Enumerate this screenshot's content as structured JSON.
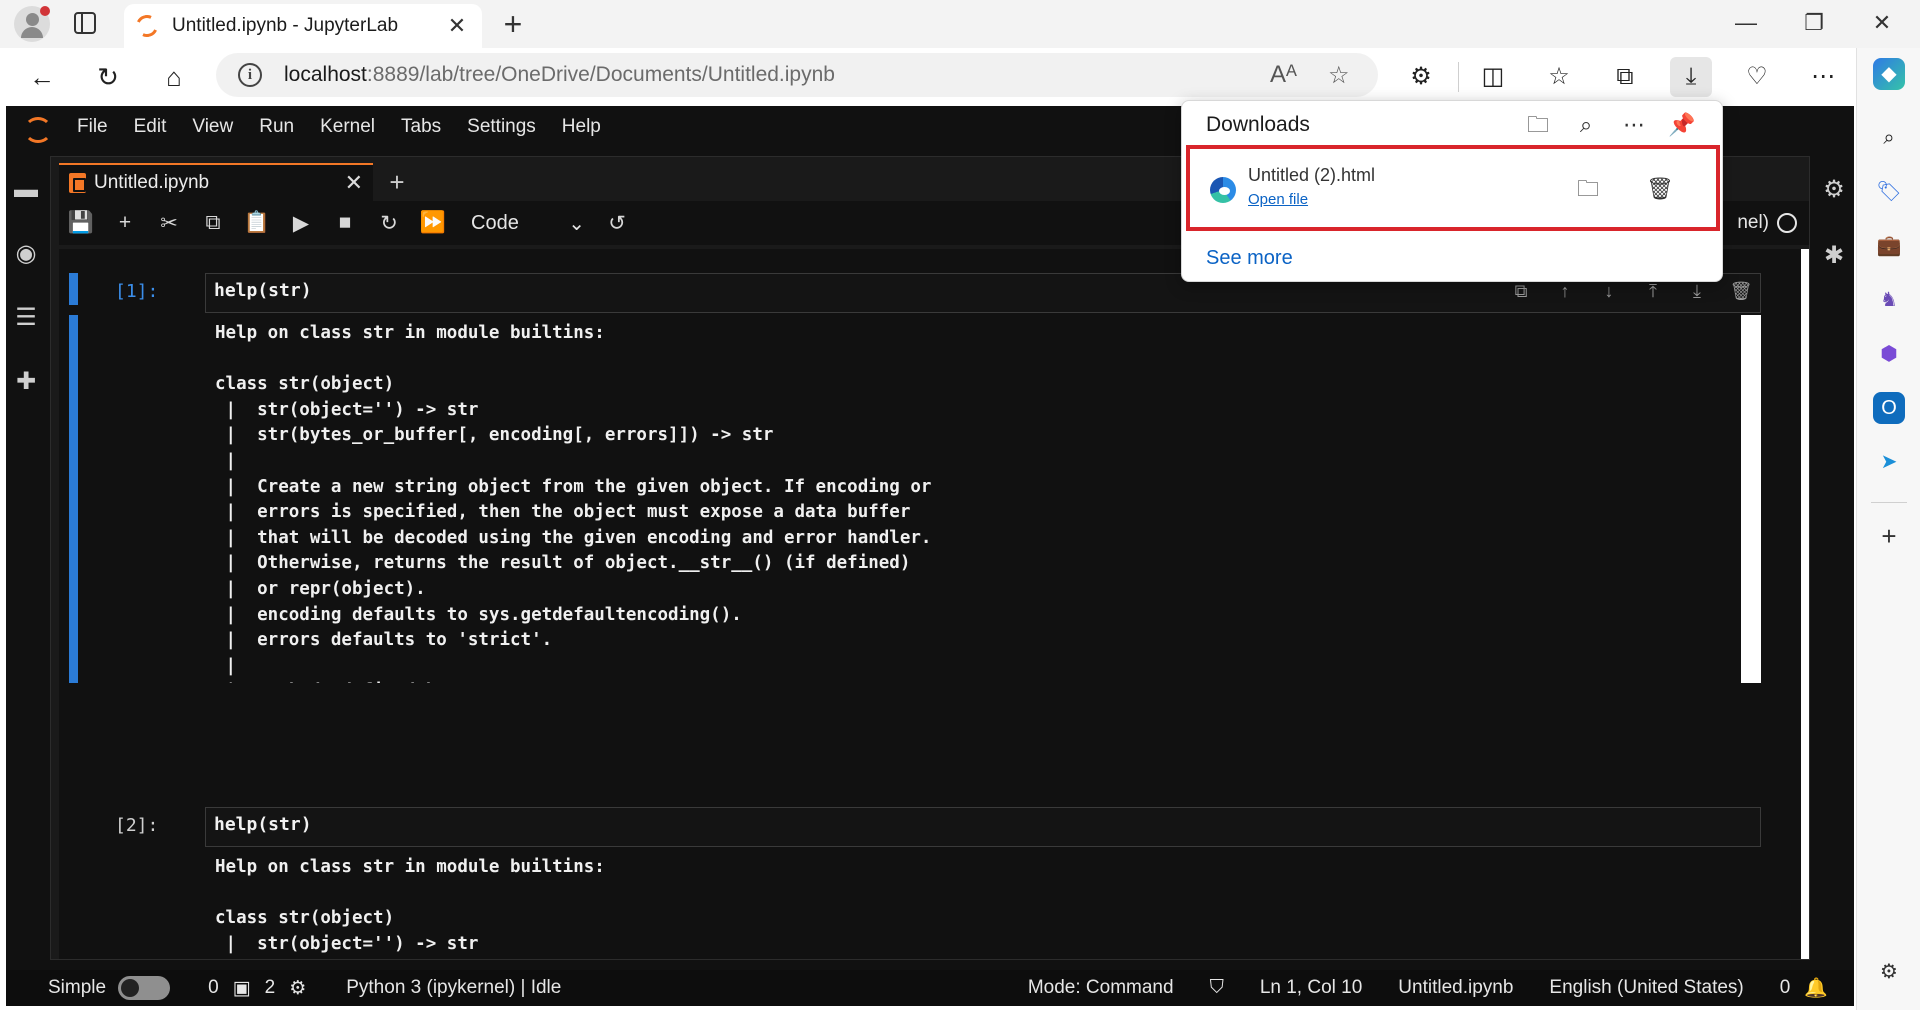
{
  "browser": {
    "tab_title": "Untitled.ipynb - JupyterLab",
    "url_host": "localhost",
    "url_rest": ":8889/lab/tree/OneDrive/Documents/Untitled.ipynb"
  },
  "jupyter": {
    "menu": [
      "File",
      "Edit",
      "View",
      "Run",
      "Kernel",
      "Tabs",
      "Settings",
      "Help"
    ],
    "notebook_tab": "Untitled.ipynb",
    "cell_type": "Code",
    "kernel_stub": "nel)",
    "cells": [
      {
        "prompt": "[1]:",
        "source": "help(str)",
        "output": "Help on class str in module builtins:\n\nclass str(object)\n |  str(object='') -> str\n |  str(bytes_or_buffer[, encoding[, errors]]) -> str\n |\n |  Create a new string object from the given object. If encoding or\n |  errors is specified, then the object must expose a data buffer\n |  that will be decoded using the given encoding and error handler.\n |  Otherwise, returns the result of object.__str__() (if defined)\n |  or repr(object).\n |  encoding defaults to sys.getdefaultencoding().\n |  errors defaults to 'strict'.\n |\n |  Methods defined here:\n |\n |  __add__(self, value, /)\n |      Return self+value."
      },
      {
        "prompt": "[2]:",
        "source": "help(str)",
        "output": "Help on class str in module builtins:\n\nclass str(object)\n |  str(object='') -> str\n |  str(bytes_or_buffer[, encoding[, errors]]) -> str"
      }
    ],
    "status": {
      "mode_label": "Simple",
      "count_a": "0",
      "count_b": "2",
      "kernel": "Python 3 (ipykernel) | Idle",
      "mode": "Mode: Command",
      "position": "Ln 1, Col 10",
      "file": "Untitled.ipynb",
      "language": "English (United States)",
      "notifications": "0"
    }
  },
  "downloads": {
    "title": "Downloads",
    "file_name": "Untitled (2).html",
    "open_label": "Open file",
    "see_more": "See more"
  }
}
